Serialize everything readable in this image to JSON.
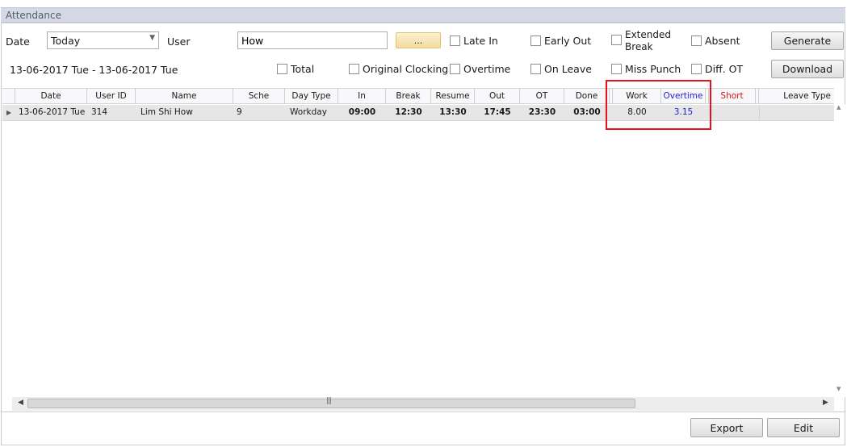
{
  "panel": {
    "title": "Attendance"
  },
  "filters": {
    "date_label": "Date",
    "date_value": "Today",
    "user_label": "User",
    "user_value": "How",
    "browse_label": "...",
    "date_range": "13-06-2017 Tue - 13-06-2017 Tue"
  },
  "checkboxes": {
    "late_in": "Late In",
    "early_out": "Early Out",
    "extended_break_line1": "Extended",
    "extended_break_line2": "Break",
    "absent": "Absent",
    "total": "Total",
    "original_clocking": "Original Clocking",
    "overtime": "Overtime",
    "on_leave": "On Leave",
    "miss_punch": "Miss Punch",
    "diff_ot": "Diff. OT"
  },
  "buttons": {
    "generate": "Generate",
    "download": "Download",
    "export": "Export",
    "edit": "Edit"
  },
  "table": {
    "columns": [
      "Date",
      "User ID",
      "Name",
      "Sche",
      "Day Type",
      "In",
      "Break",
      "Resume",
      "Out",
      "OT",
      "Done",
      "Work",
      "Overtime",
      "Short",
      "Leave Type"
    ],
    "rows": [
      [
        "13-06-2017  Tue",
        "314",
        "Lim Shi How",
        "9",
        "Workday",
        "09:00",
        "12:30",
        "13:30",
        "17:45",
        "23:30",
        "03:00",
        "8.00",
        "3.15",
        "",
        ""
      ]
    ]
  },
  "colors": {
    "overtime_header": "#1d1dd6",
    "short_header": "#d11a1a",
    "highlight_box": "#e8101a"
  }
}
